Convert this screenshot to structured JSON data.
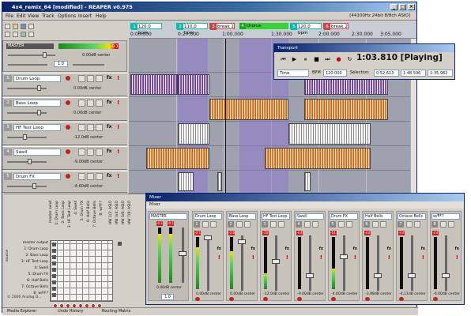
{
  "window": {
    "title": "4x4_remix_64 [modified] - REAPER v0.975",
    "audio_status": "[44100Hz 24bit 8/8ch ASIO]"
  },
  "menu": [
    "File",
    "Edit",
    "View",
    "Track",
    "Options",
    "Insert",
    "Help"
  ],
  "master": {
    "label": "MASTER",
    "meter_peak": "-0.1",
    "db_readout": "0.00dB center",
    "rate": "1.0"
  },
  "tracks": [
    {
      "num": "1",
      "name": "Drum Loop",
      "db": "0.00dB center"
    },
    {
      "num": "2",
      "name": "Bass Loop",
      "db": "0.00dB center"
    },
    {
      "num": "3",
      "name": "HF Test Loop",
      "db": "-12.0dB center"
    },
    {
      "num": "4",
      "name": "Swell",
      "db": "-9.00dB center"
    },
    {
      "num": "5",
      "name": "Drum FX",
      "db": "-4.60dB center"
    }
  ],
  "fx_label": "fx",
  "excl_label": "!",
  "ruler": {
    "markers": [
      {
        "num": "1",
        "text": "120.0 bpm",
        "kind": "bpm"
      },
      {
        "num": "2",
        "text": "110.0 bpm",
        "kind": "bpm"
      },
      {
        "num": "3",
        "text": "break 1",
        "kind": "region"
      },
      {
        "num": "4",
        "text": "chorus",
        "kind": "chorus"
      },
      {
        "num": "5",
        "text": "120.0 bpm",
        "kind": "bpm"
      },
      {
        "num": "6",
        "text": "break 2",
        "kind": "region"
      }
    ],
    "times": [
      "0:00.000",
      "0:27.000",
      "1:00.000",
      "1:30.000",
      "2:00.000",
      "2:30.000",
      "3:05.000"
    ]
  },
  "transport": {
    "title": "Transport",
    "time": "1:03.810 [Playing]",
    "timebase": "Time",
    "bpm_label": "BPM",
    "bpm": "120.000",
    "selection_label": "Selection:",
    "sel_start": "0:52.613",
    "sel_end": "1:48.596",
    "sel_len": "1:35.982"
  },
  "matrix": {
    "column_labels": [
      "master send",
      "1: Drum Loop",
      "2: Bass Loop",
      "3: HF Test Loop",
      "4: Swell",
      "5: Drum FX",
      "6: Half Bells",
      "7: Octave Bells",
      "8: w/FF?",
      "HW 1/2: ASIO",
      "HW 3/4: ASIO",
      "HW 5/6: ASIO",
      "HW 7/8: ASIO"
    ],
    "row_labels": [
      "master output",
      "1: Drum Loop",
      "2: Bass Loop",
      "3: HF Test Loop",
      "4: Swell",
      "5: Drum FX",
      "6: Half Bells",
      "7: Octave Bells",
      "8: w/FF?"
    ],
    "source_label": "source",
    "copyright": "© 2006 Analog D..."
  },
  "mixer": {
    "title": "Mixer",
    "menu_label": "Mixer",
    "master_db": "0.00dB center",
    "master_rate": "1.0",
    "strips": [
      {
        "num": "1",
        "name": "Drum Loop",
        "peak": "-0.1",
        "db": "0.00dB center",
        "level": 0.8
      },
      {
        "num": "2",
        "name": "Bass Loop",
        "peak": "-3.6",
        "db": "0.00dB center",
        "level": 0.72
      },
      {
        "num": "3",
        "name": "HF Test Loop",
        "peak": "-20",
        "db": "-12.0dB center",
        "level": 0.3
      },
      {
        "num": "4",
        "name": "Swell",
        "peak": "-inf",
        "db": "-9.00dB center",
        "level": 0.0
      },
      {
        "num": "5",
        "name": "Drum FX",
        "peak": "-14.4",
        "db": "-4.60dB center",
        "level": 0.4
      },
      {
        "num": "6",
        "name": "Half Bells",
        "peak": "-inf",
        "db": "-3.98dB center",
        "level": 0.0
      },
      {
        "num": "7",
        "name": "Octave Bells",
        "peak": "-inf",
        "db": "-4.11dB center",
        "level": 0.0
      },
      {
        "num": "8",
        "name": "w/FF?",
        "peak": "-inf",
        "db": "-6.00dB center",
        "level": 0.0
      }
    ]
  },
  "bottom_tabs": [
    "Media Explorer",
    "Undo History",
    "Routing Matrix"
  ]
}
